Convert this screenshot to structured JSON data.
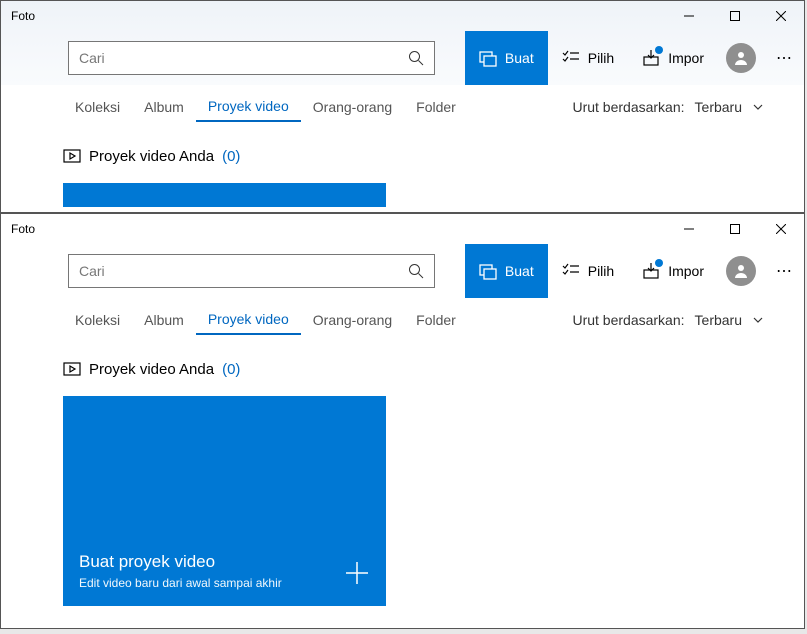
{
  "app_title": "Foto",
  "search": {
    "placeholder": "Cari"
  },
  "toolbar": {
    "create": "Buat",
    "select": "Pilih",
    "import": "Impor"
  },
  "tabs": {
    "koleksi": "Koleksi",
    "album": "Album",
    "proyek_video": "Proyek video",
    "orang": "Orang-orang",
    "folder": "Folder"
  },
  "sort": {
    "label": "Urut berdasarkan:",
    "value": "Terbaru"
  },
  "section": {
    "title": "Proyek video Anda",
    "count": "(0)"
  },
  "tile": {
    "title": "Buat proyek video",
    "subtitle": "Edit video baru dari awal sampai akhir"
  }
}
